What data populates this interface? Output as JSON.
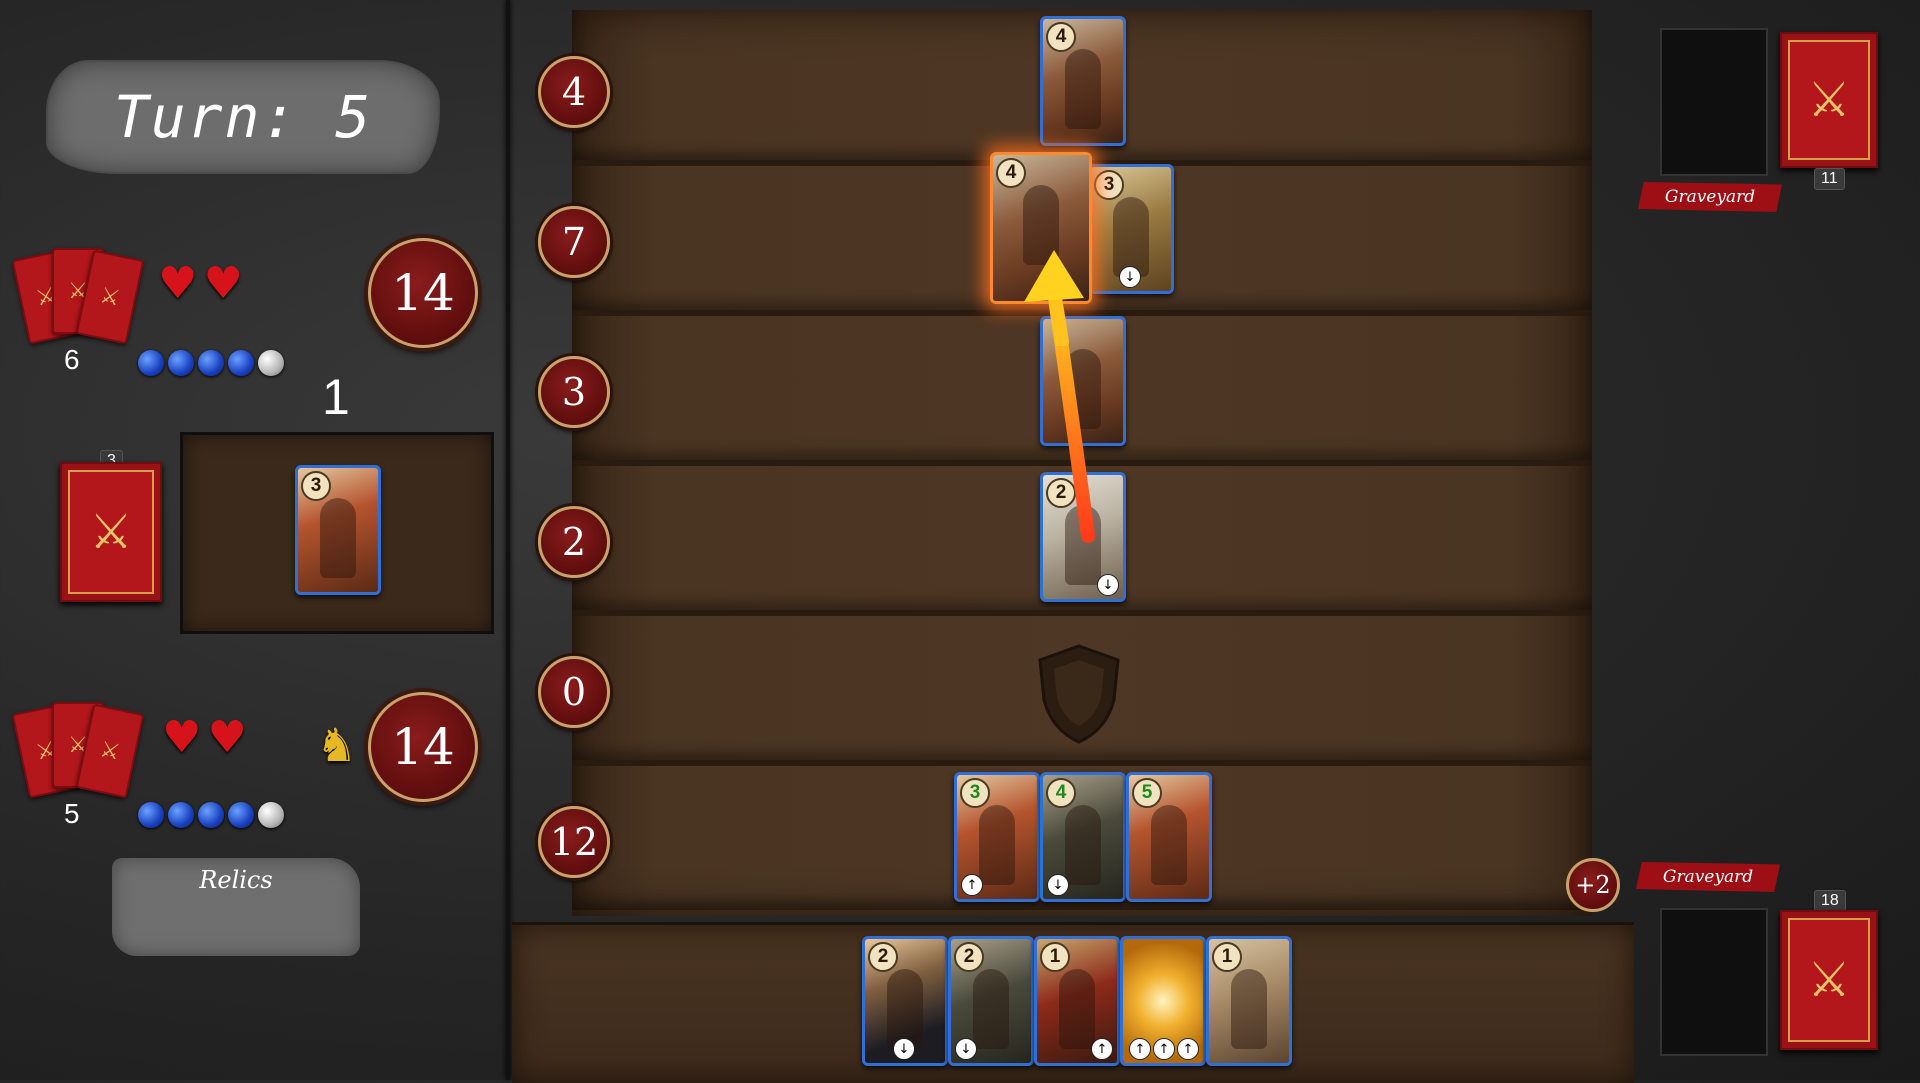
{
  "turn": {
    "label": "Turn: 5"
  },
  "opponent": {
    "hand_count": "6",
    "hearts": 2,
    "mana_filled": 4,
    "mana_total": 5,
    "health": "14",
    "deck_count": "11"
  },
  "player": {
    "hand_count": "5",
    "hearts": 2,
    "mana_filled": 4,
    "mana_total": 5,
    "health": "14",
    "deck_count": "18",
    "bonus": "+2"
  },
  "play_area": {
    "label": "1",
    "deck_badge": "3",
    "card": {
      "cost": "3",
      "art": "roman-legionary"
    }
  },
  "relics": {
    "label": "Relics"
  },
  "lanes": [
    {
      "value": "4",
      "cards": [
        {
          "cost": "4",
          "art": "brute"
        }
      ]
    },
    {
      "value": "7",
      "cards": [
        {
          "cost": "4",
          "art": "brute",
          "selected": true
        },
        {
          "cost": "3",
          "art": "lion",
          "badge": "↓"
        }
      ]
    },
    {
      "value": "3",
      "cards": [
        {
          "cost": "",
          "art": "brute"
        }
      ]
    },
    {
      "value": "2",
      "cards": [
        {
          "cost": "2",
          "art": "rider",
          "badge": "↓"
        }
      ]
    },
    {
      "value": "0",
      "cards": [],
      "empty_icon": "shield-icon"
    },
    {
      "value": "12",
      "cards": [
        {
          "cost": "3",
          "art": "roman",
          "badge": "↑"
        },
        {
          "cost": "4",
          "art": "archer",
          "badge": "↓"
        },
        {
          "cost": "5",
          "art": "roman"
        }
      ]
    }
  ],
  "hand": [
    {
      "cost": "2",
      "art": "shadow",
      "badges": [
        "↓"
      ]
    },
    {
      "cost": "2",
      "art": "archer",
      "badges": [
        "↓"
      ]
    },
    {
      "cost": "1",
      "art": "spartan",
      "badges": [
        "↑"
      ]
    },
    {
      "cost": "",
      "art": "gold",
      "badges": [
        "↑",
        "↑",
        "↑"
      ]
    },
    {
      "cost": "1",
      "art": "monk",
      "badges": []
    }
  ],
  "graveyard": {
    "top_label": "Graveyard",
    "bottom_label": "Graveyard"
  },
  "colors": {
    "accent_red": "#9d0f14",
    "card_border": "#2f6fd6",
    "selection_glow": "#ff8a2b",
    "gold_trim": "#c9a26b"
  },
  "icons": {
    "deck": "crossed-swords-icon",
    "heart": "heart-icon",
    "mana": "mana-orb-icon",
    "knight": "knight-icon",
    "shield": "shield-icon"
  }
}
